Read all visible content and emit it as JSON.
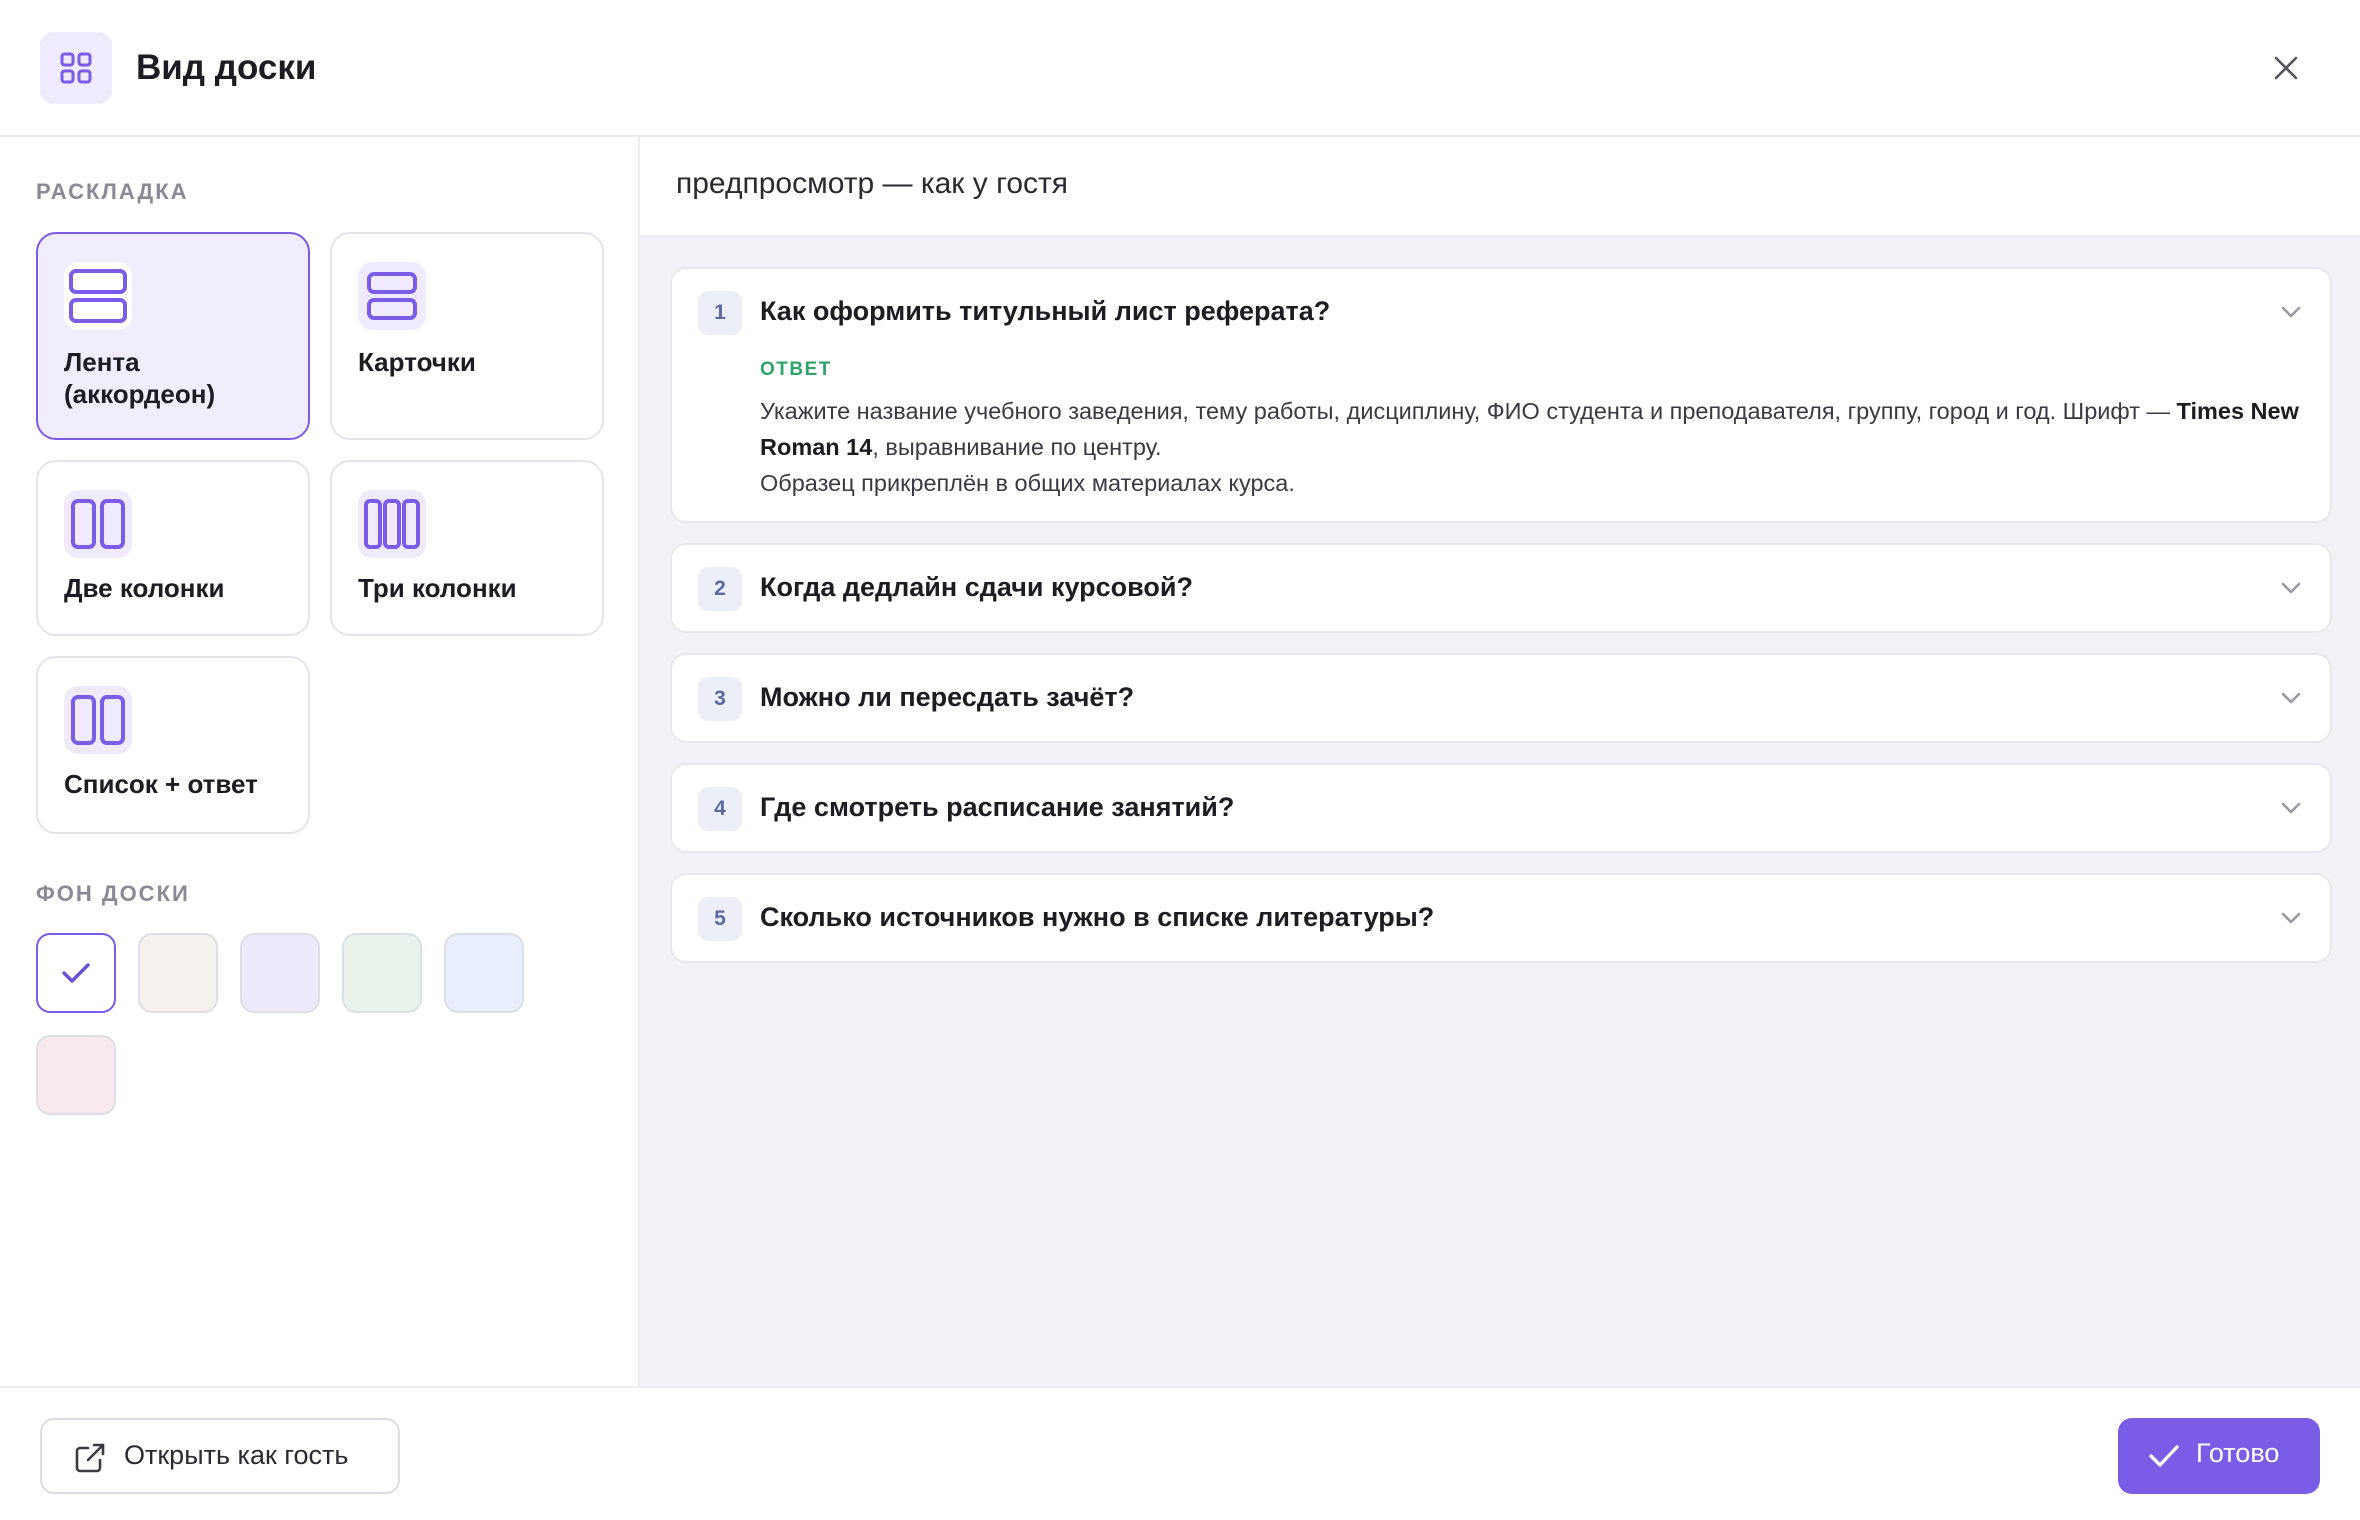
{
  "header": {
    "title": "Вид доски",
    "icon": "grid-icon"
  },
  "sidebar": {
    "layout_label": "РАСКЛАДКА",
    "layouts": [
      {
        "label": "Лента (аккордеон)",
        "icon": "rows-icon",
        "selected": true
      },
      {
        "label": "Карточки",
        "icon": "rows-icon",
        "selected": false
      },
      {
        "label": "Две колонки",
        "icon": "two-columns-icon",
        "selected": false
      },
      {
        "label": "Три колонки",
        "icon": "three-columns-icon",
        "selected": false
      },
      {
        "label": "Список + ответ",
        "icon": "two-columns-icon",
        "selected": false
      }
    ],
    "background_label": "ФОН ДОСКИ",
    "swatches": [
      {
        "color": "#ffffff",
        "selected": true
      },
      {
        "color": "#f5f1ec",
        "selected": false
      },
      {
        "color": "#efeafb",
        "selected": false
      },
      {
        "color": "#e9f3ec",
        "selected": false
      },
      {
        "color": "#e8eefb",
        "selected": false
      },
      {
        "color": "#f8e9ee",
        "selected": false
      }
    ]
  },
  "preview": {
    "title": "предпросмотр — как у гостя",
    "answer_label": "ОТВЕТ",
    "items": [
      {
        "num": "1",
        "question": "Как оформить титульный лист реферата?",
        "expanded": true,
        "answer_part1": "Укажите название учебного заведения, тему работы, дисциплину, ФИО студента и преподавателя, группу, город и год. Шрифт —",
        "answer_bold": "Times New Roman 14",
        "answer_part2": ", выравнивание по центру.",
        "answer_part3": "Образец прикреплён в общих материалах курса."
      },
      {
        "num": "2",
        "question": "Когда дедлайн сдачи курсовой?",
        "expanded": false
      },
      {
        "num": "3",
        "question": "Можно ли пересдать зачёт?",
        "expanded": false
      },
      {
        "num": "4",
        "question": "Где смотреть расписание занятий?",
        "expanded": false
      },
      {
        "num": "5",
        "question": "Сколько источников нужно в списке литературы?",
        "expanded": false
      }
    ]
  },
  "footer": {
    "guest_button": "Открыть как гость",
    "done_button": "Готово"
  },
  "colors": {
    "accent": "#7b5ce6",
    "answer_label": "#2ea36a"
  }
}
